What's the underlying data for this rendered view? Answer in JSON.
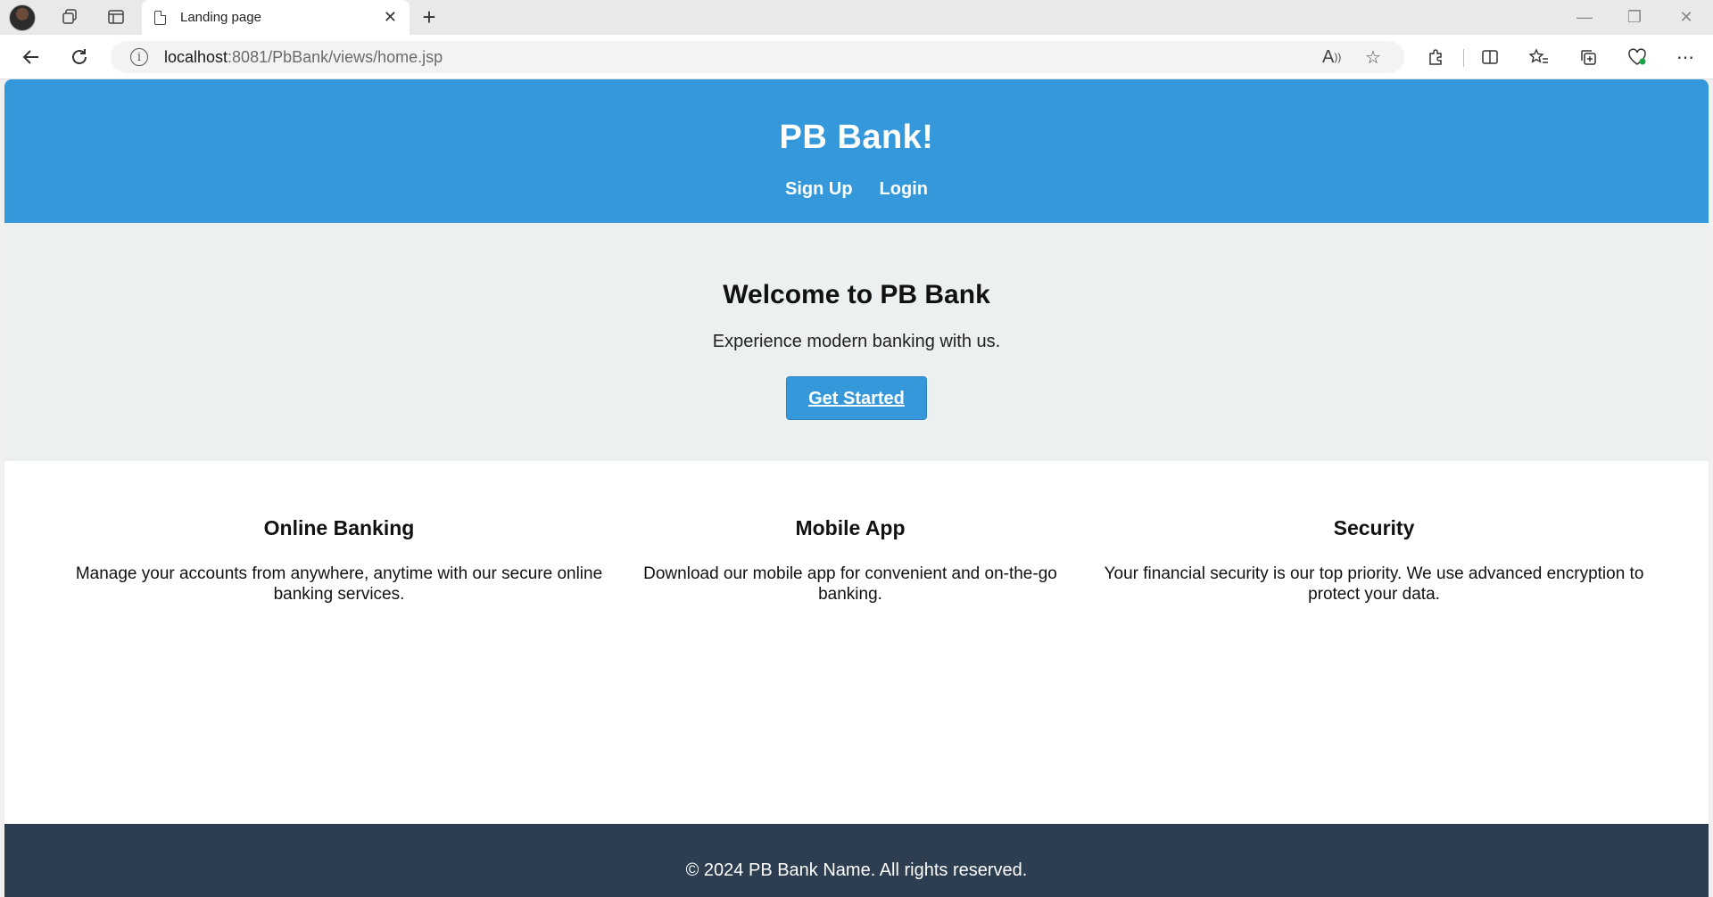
{
  "browser": {
    "tab_title": "Landing page",
    "url_host": "localhost",
    "url_path": ":8081/PbBank/views/home.jsp",
    "icons": [
      "back-icon",
      "reload-icon",
      "info-icon",
      "read-aloud-icon",
      "favorite-star-icon",
      "extensions-icon",
      "split-screen-icon",
      "favorites-icon",
      "collections-icon",
      "browser-essentials-icon",
      "more-icon"
    ]
  },
  "header": {
    "title": "PB Bank!",
    "nav": {
      "signup": "Sign Up",
      "login": "Login"
    }
  },
  "hero": {
    "heading": "Welcome to PB Bank",
    "subtext": "Experience modern banking with us.",
    "cta": "Get Started"
  },
  "features": [
    {
      "title": "Online Banking",
      "text": "Manage your accounts from anywhere, anytime with our secure online banking services."
    },
    {
      "title": "Mobile App",
      "text": "Download our mobile app for convenient and on-the-go banking."
    },
    {
      "title": "Security",
      "text": "Your financial security is our top priority. We use advanced encryption to protect your data."
    }
  ],
  "footer": {
    "text": "© 2024 PB Bank Name. All rights reserved."
  },
  "colors": {
    "primary": "#3498db",
    "hero_bg": "#ecf0f1",
    "footer_bg": "#2c3e50"
  }
}
